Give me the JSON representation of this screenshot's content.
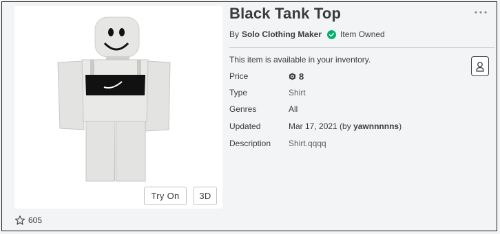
{
  "item": {
    "title": "Black Tank Top",
    "by_label": "By",
    "creator": "Solo Clothing Maker",
    "owned_text": "Item Owned",
    "availability": "This item is available in your inventory."
  },
  "details": {
    "price_label": "Price",
    "price_value": "8",
    "type_label": "Type",
    "type_value": "Shirt",
    "genres_label": "Genres",
    "genres_value": "All",
    "updated_label": "Updated",
    "updated_date": "Mar 17, 2021 (by ",
    "updated_by": "yawnnnnns",
    "updated_close": ")",
    "description_label": "Description",
    "description_value": "Shirt.qqqq"
  },
  "buttons": {
    "try_on": "Try On",
    "three_d": "3D"
  },
  "favorites": {
    "count": "605"
  },
  "icons": {
    "more": "more-icon",
    "owned": "check-circle-icon",
    "robux": "robux-icon",
    "favorite": "star-outline-icon",
    "wear": "wear-icon"
  },
  "colors": {
    "owned_green": "#00b06f",
    "text": "#393b3d",
    "background": "#f2f4f5"
  }
}
